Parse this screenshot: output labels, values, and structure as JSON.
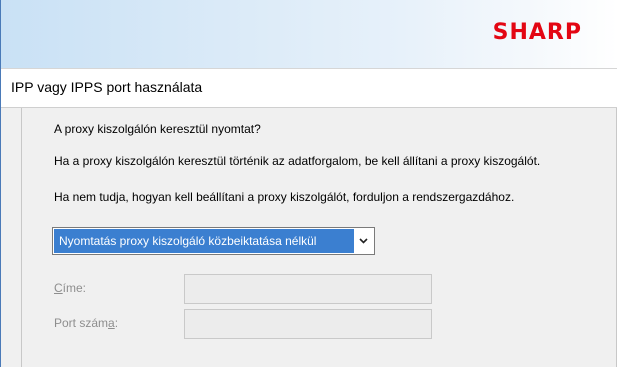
{
  "brand": {
    "logo_text": "SHARP",
    "logo_color": "#e30613",
    "banner_color": "#cfe4f6"
  },
  "page": {
    "title": "IPP vagy IPPS port használata"
  },
  "question": "A proxy kiszolgálón keresztül nyomtat?",
  "info_line_1": "Ha a proxy kiszolgálón keresztül történik az adatforgalom, be kell állítani a proxy kiszogálót.",
  "info_line_2": "Ha nem tudja, hogyan kell beállítani a proxy kiszolgálót, forduljon a rendszergazdához.",
  "proxy_select": {
    "selected": "Nyomtatás proxy kiszolgáló közbeiktatása nélkül",
    "highlight_color": "#3b7fd0",
    "icon": "chevron-down-icon"
  },
  "fields": {
    "address": {
      "label_access_key": "C",
      "label_rest": "íme:",
      "value": "",
      "enabled": false
    },
    "port": {
      "label_prefix": "Port szám",
      "label_access_key": "a",
      "label_suffix": ":",
      "value": "",
      "enabled": false
    }
  }
}
